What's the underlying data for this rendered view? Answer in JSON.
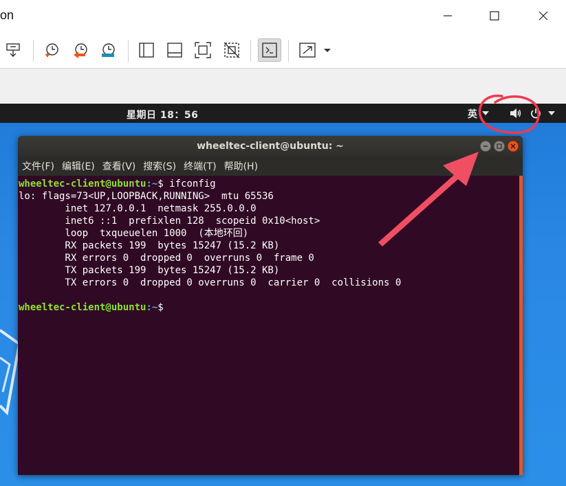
{
  "host": {
    "title_fragment": "on",
    "window_controls": [
      "minimize",
      "maximize",
      "close"
    ],
    "toolbar_icons": [
      "network-adapter-icon",
      "snapshot-icon",
      "restore-snapshot-icon",
      "manage-snapshots-icon",
      "sidebar-view-icon",
      "bottom-panel-view-icon",
      "fullscreen-icon",
      "unity-mode-icon",
      "console-view-icon",
      "stretch-view-icon"
    ]
  },
  "guest": {
    "topbar": {
      "clock": "星期日 18：56",
      "input_method": "英"
    },
    "terminal": {
      "title": "wheeltec-client@ubuntu: ~",
      "menu": [
        "文件(F)",
        "编辑(E)",
        "查看(V)",
        "搜索(S)",
        "终端(T)",
        "帮助(H)"
      ],
      "prompt_user": "wheeltec-client@ubuntu",
      "prompt_path": ":~",
      "prompt_symbol": "$ ",
      "command": "ifconfig",
      "output": [
        "lo: flags=73<UP,LOOPBACK,RUNNING>  mtu 65536",
        "        inet 127.0.0.1  netmask 255.0.0.0",
        "        inet6 ::1  prefixlen 128  scopeid 0x10<host>",
        "        loop  txqueuelen 1000  (本地环回)",
        "        RX packets 199  bytes 15247 (15.2 KB)",
        "        RX errors 0  dropped 0  overruns 0  frame 0",
        "        TX packets 199  bytes 15247 (15.2 KB)",
        "        TX errors 0  dropped 0 overruns 0  carrier 0  collisions 0",
        ""
      ]
    }
  },
  "colors": {
    "terminal_bg": "#300a24",
    "prompt_user": "#8ae234",
    "prompt_path": "#729fcf",
    "annotation": "#f0394f"
  }
}
